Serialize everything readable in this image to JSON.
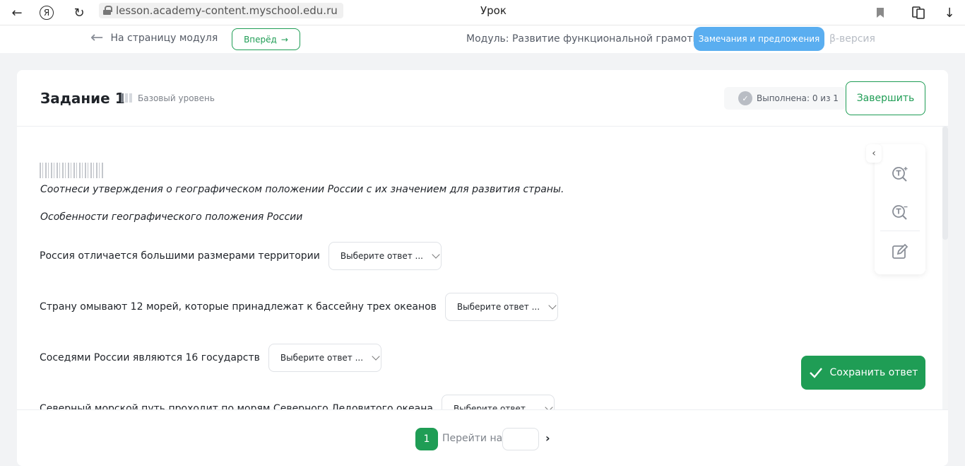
{
  "browser": {
    "url": "lesson.academy-content.myschool.edu.ru",
    "tab_title": "Урок",
    "back_icon": "←",
    "ya_icon": "Я",
    "reload_icon": "↻",
    "bookmark_icon": "🔖",
    "download_icon": "↓"
  },
  "top_nav": {
    "back_label": "На страницу модуля",
    "forward_label": "Вперёд",
    "module_title": "Модуль: Развитие функциональной грамотности",
    "feedback_label": "Замечания и предложения",
    "beta_label": "β-версия"
  },
  "task": {
    "title": "Задание 1",
    "level": "Базовый уровень",
    "done_label": "Выполнена: 0 из 1",
    "finish_label": "Завершить",
    "instruction": "Соотнеси утверждения о географическом положении России с их значением для развития страны.",
    "section_title": "Особенности географического положения России",
    "questions": [
      {
        "text": "Россия отличается большими размерами территории",
        "select": "Выберите ответ ..."
      },
      {
        "text": "Страну омывают 12 морей, которые принадлежат к бассейну трех океанов",
        "select": "Выберите ответ ..."
      },
      {
        "text": "Соседями России являются 16 государств",
        "select": "Выберите ответ ..."
      },
      {
        "text": "Северный морской путь проходит по морям Северного Ледовитого океана",
        "select": "Выберите ответ ..."
      }
    ],
    "save_label": "Сохранить ответ"
  },
  "pager": {
    "current_page": "1",
    "goto_label": "Перейти на",
    "goto_value": "",
    "next_icon": "›"
  },
  "colors": {
    "accent_green": "#1f9d55",
    "feedback_blue": "#5aaef0"
  }
}
